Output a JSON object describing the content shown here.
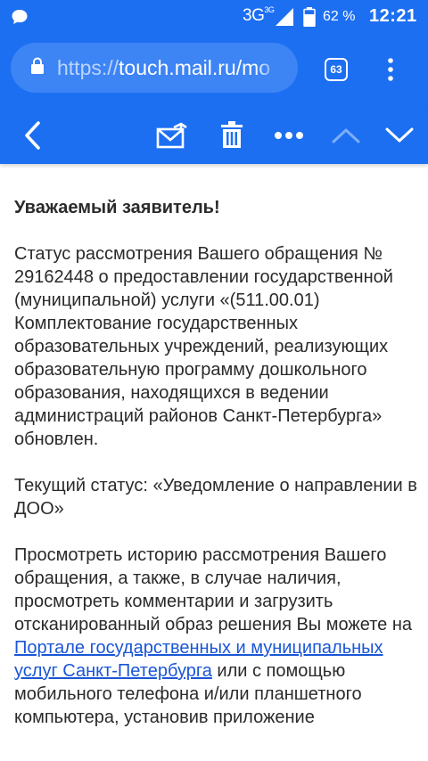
{
  "status_bar": {
    "network": "3G",
    "network_sup": "3G",
    "battery_percent": "62 %",
    "time": "12:21"
  },
  "browser": {
    "url_protocol": "https://",
    "url_host": "touch.mail.ru/mo",
    "tab_count": "63"
  },
  "toolbar": {
    "icons": [
      "back-icon",
      "move-mail-icon",
      "trash-icon",
      "more-icon",
      "chevron-up-icon",
      "chevron-down-icon"
    ]
  },
  "message": {
    "greeting": "Уважаемый заявитель!",
    "p1": "Статус рассмотрения Вашего обращения № 29162448 о предоставлении государственной (муниципальной) услуги «(511.00.01) Комплектование государственных образовательных учреждений, реализующих образовательную программу дошкольного образования, находящихся в ведении администраций районов Санкт-Петербурга» обновлен.",
    "p2": "Текущий статус: «Уведомление о направлении в ДОО»",
    "p3_before": "Просмотреть историю рассмотрения Вашего обращения, а также, в случае наличия, просмотреть комментарии и загрузить отсканированный образ решения Вы можете на ",
    "p3_link": "Портале государственных и муниципальных услуг Санкт-Петербурга",
    "p3_after": " или с помощью мобильного телефона и/или планшетного компьютера, установив приложение"
  },
  "colors": {
    "primary": "#1d6ff2",
    "url_box": "#3d84f5",
    "link": "#1a56d6"
  }
}
